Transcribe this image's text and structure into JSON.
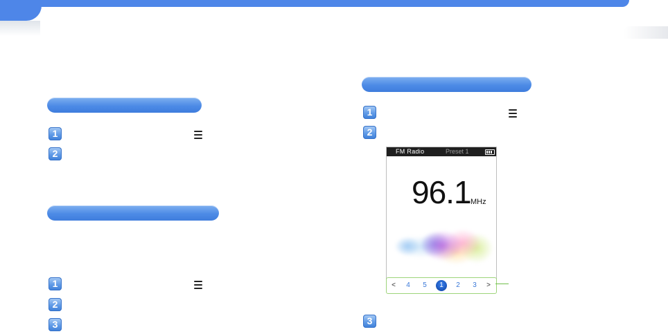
{
  "colors": {
    "accent_blue": "#4e86e8",
    "pill_blue": "#4d8be6",
    "nav_highlight_green": "#9dd47a",
    "callout_green": "#6fbf4a"
  },
  "left_column": {
    "section1": {
      "steps": [
        {
          "number": "1",
          "has_menu_icon": true
        },
        {
          "number": "2"
        }
      ]
    },
    "section2": {
      "steps": [
        {
          "number": "1",
          "has_menu_icon": true
        },
        {
          "number": "2"
        },
        {
          "number": "3"
        }
      ]
    }
  },
  "right_column": {
    "section": {
      "steps": [
        {
          "number": "1",
          "has_menu_icon": true
        },
        {
          "number": "2"
        },
        {
          "number": "3"
        }
      ]
    },
    "device_screen": {
      "status_title": "FM Radio",
      "status_preset": "Preset 1",
      "battery_icon": "battery-icon",
      "frequency": "96.1",
      "unit": "MHz",
      "preset_bar": {
        "prev_arrow": "<",
        "next_arrow": ">",
        "presets": [
          "4",
          "5",
          "1",
          "2",
          "3"
        ],
        "active_preset": "1"
      }
    }
  },
  "icons": {
    "menu": "menu-icon"
  }
}
